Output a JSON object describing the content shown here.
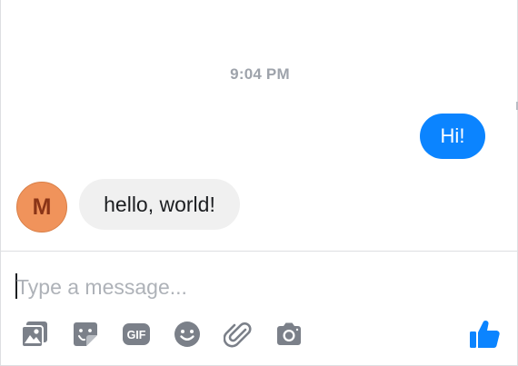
{
  "conversation": {
    "timestamp": "9:04 PM",
    "messages": [
      {
        "direction": "outgoing",
        "text": "Hi!"
      },
      {
        "direction": "incoming",
        "sender_initial": "M",
        "text": "hello, world!"
      }
    ]
  },
  "composer": {
    "placeholder": "Type a message...",
    "value": ""
  },
  "toolbar": {
    "icons": [
      "photo-icon",
      "sticker-icon",
      "gif-icon",
      "emoji-icon",
      "attachment-icon",
      "camera-icon"
    ],
    "gif_label": "GIF",
    "send_icon": "thumbs-up-icon"
  },
  "colors": {
    "accent": "#0b84ff",
    "outgoing_bubble": "#0b84ff",
    "incoming_bubble": "#f0f0f0",
    "avatar": "#f0935b",
    "icon_gray": "#7b8089",
    "timestamp": "#9ea3ab"
  }
}
